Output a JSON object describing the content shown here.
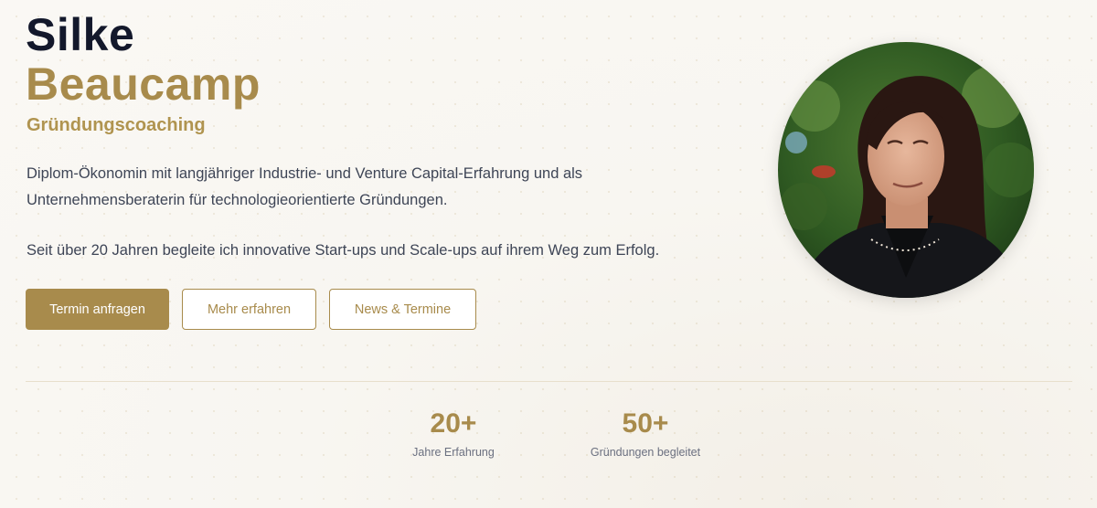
{
  "hero": {
    "first_name": "Silke",
    "last_name": "Beaucamp",
    "subtitle": "Gründungscoaching",
    "intro_line1": "Diplom-Ökonomin mit langjähriger Industrie- und Venture Capital-Erfahrung und als",
    "intro_line2": "Unternehmensberaterin für technologieorientierte Gründungen.",
    "intro_paragraph2": "Seit über 20 Jahren begleite ich innovative Start-ups und Scale-ups auf ihrem Weg zum Erfolg."
  },
  "buttons": {
    "primary": "Termin anfragen",
    "more": "Mehr erfahren",
    "news": "News & Termine"
  },
  "stats": [
    {
      "value": "20+",
      "label": "Jahre Erfahrung"
    },
    {
      "value": "50+",
      "label": "Gründungen begleitet"
    }
  ],
  "colors": {
    "accent": "#a88b4c",
    "heading": "#13182b",
    "text": "#3e4556"
  }
}
